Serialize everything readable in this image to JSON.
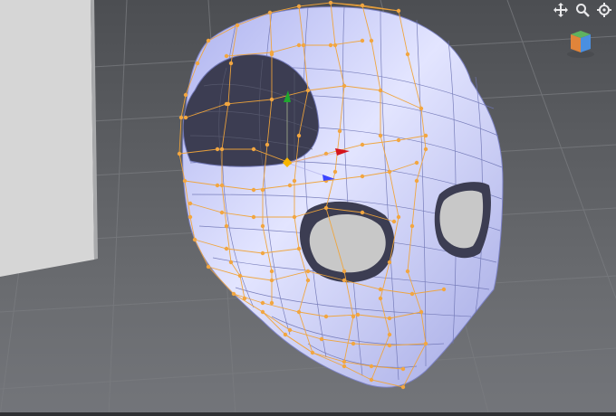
{
  "app": {
    "viewport_type": "3d-modeling-viewport"
  },
  "nav_controls": [
    {
      "id": "move",
      "icon": "move-icon"
    },
    {
      "id": "zoom",
      "icon": "zoom-icon"
    },
    {
      "id": "orbit",
      "icon": "orbit-icon"
    }
  ],
  "colors": {
    "background": "#5d5f63",
    "grid_line": "#7a7c80",
    "reference_plane": "#d6d6d6",
    "mesh_surface": "#c9cdf6",
    "mesh_shadow": "#8f95cf",
    "eye_socket": "#3c3d52",
    "eye_inner": "#c8c8c8",
    "cage_wire": "#f0a43a",
    "cage_vertex": "#f2a640",
    "gizmo_x": "#d4141b",
    "gizmo_y": "#1ea82e",
    "gizmo_z": "#3b44ff",
    "gizmo_pivot": "#f7b500"
  },
  "view_cube_faces": [
    "top",
    "front",
    "right"
  ],
  "gizmo": {
    "axes": [
      "x",
      "y",
      "z"
    ]
  }
}
